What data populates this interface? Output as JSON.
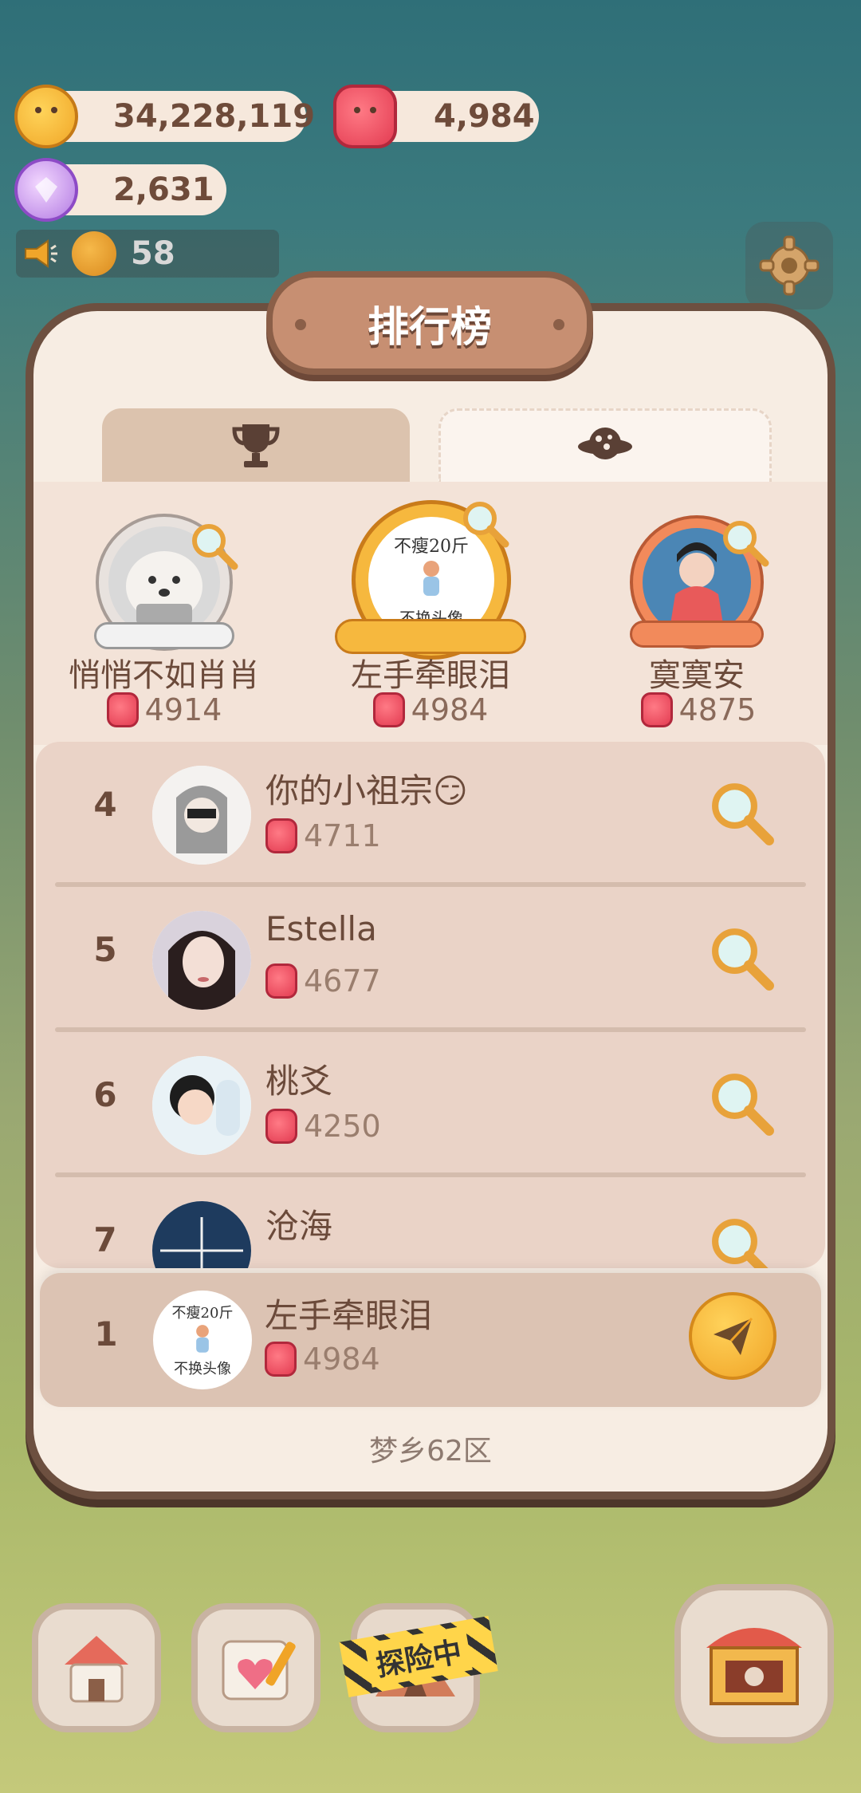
{
  "resources": {
    "cookies": "34,228,119",
    "candies": "4,984",
    "gems": "2,631"
  },
  "announce": {
    "count": "58"
  },
  "leaderboard": {
    "title": "排行榜",
    "tabs": [
      {
        "icon": "trophy-icon",
        "active": false
      },
      {
        "icon": "planet-icon",
        "active": true
      }
    ],
    "top3": [
      {
        "rank": 2,
        "name": "悄悄不如肖肖",
        "score": "4914"
      },
      {
        "rank": 1,
        "name": "左手牵眼泪",
        "score": "4984",
        "avatar_text_top": "不瘦20斤",
        "avatar_text_bottom": "不换头像"
      },
      {
        "rank": 3,
        "name": "寞寞安",
        "score": "4875"
      }
    ],
    "rows": [
      {
        "rank": "4",
        "name": "你的小祖宗😏",
        "score": "4711"
      },
      {
        "rank": "5",
        "name": "Estella",
        "score": "4677"
      },
      {
        "rank": "6",
        "name": "桃爻",
        "score": "4250"
      },
      {
        "rank": "7",
        "name": "沧海",
        "score": ""
      }
    ],
    "me": {
      "rank": "1",
      "name": "左手牵眼泪",
      "score": "4984",
      "avatar_text_top": "不瘦20斤",
      "avatar_text_bottom": "不换头像"
    },
    "server": "梦乡62区"
  },
  "bottom": {
    "explore_label": "探险中"
  },
  "colors": {
    "panel_bg": "#f7ede3",
    "panel_border": "#6d5040",
    "accent_gold": "#f6b83e"
  }
}
